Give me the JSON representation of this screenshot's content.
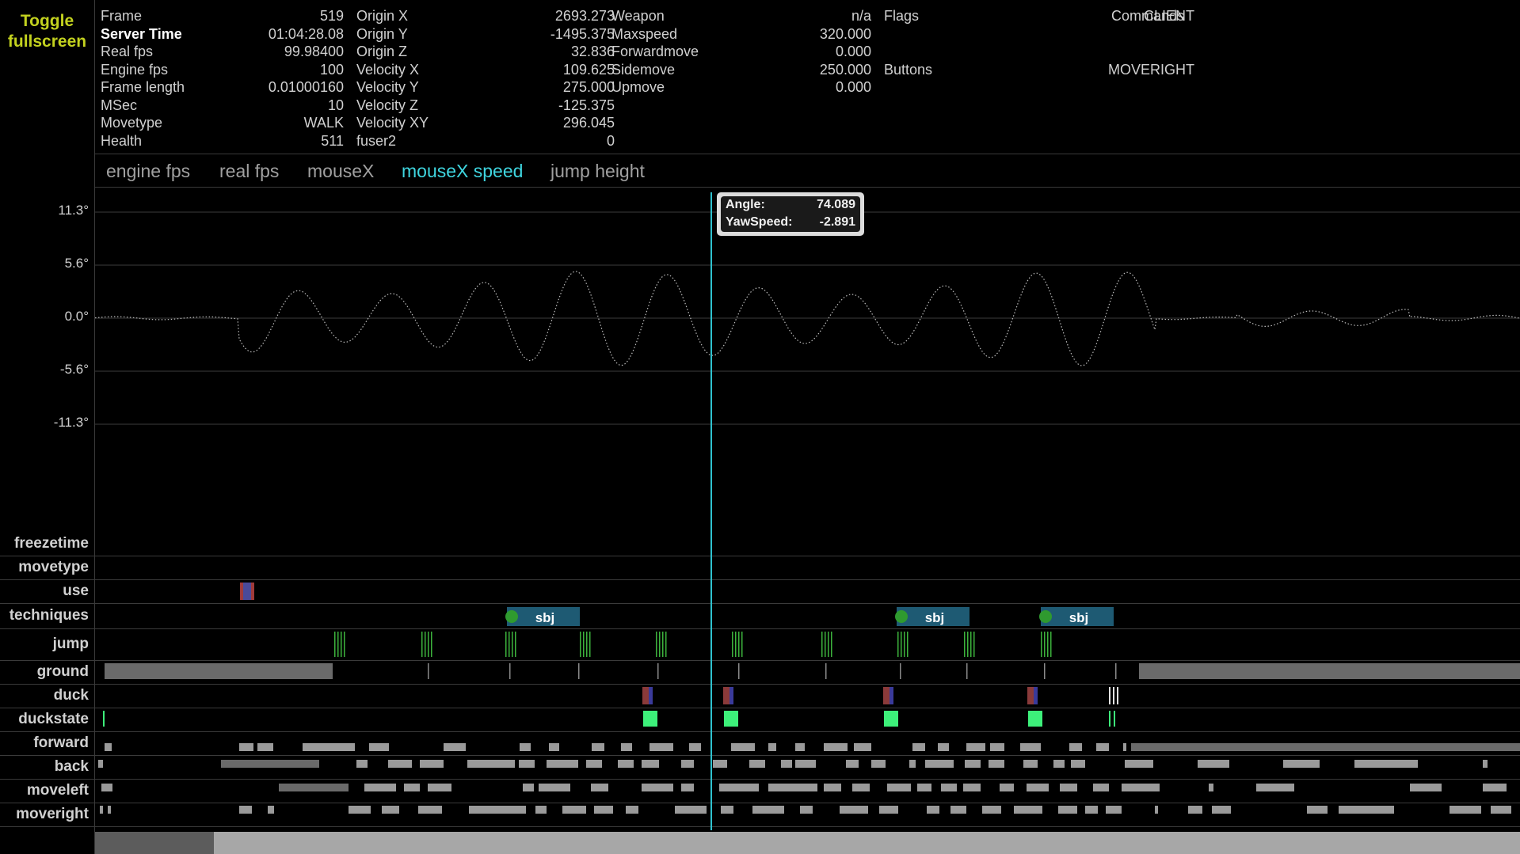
{
  "toggle": {
    "label": "Toggle fullscreen"
  },
  "info": {
    "col1": [
      {
        "label": "Frame",
        "value": "519"
      },
      {
        "label": "Server Time",
        "value": "01:04:28.08",
        "highlight": true
      },
      {
        "label": "Real fps",
        "value": "99.98400"
      },
      {
        "label": "Engine fps",
        "value": "100"
      },
      {
        "label": "Frame length",
        "value": "0.01000160"
      },
      {
        "label": "MSec",
        "value": "10"
      },
      {
        "label": "Movetype",
        "value": "WALK"
      },
      {
        "label": "Health",
        "value": "511"
      }
    ],
    "col2": [
      {
        "label": "Origin X",
        "value": "2693.273"
      },
      {
        "label": "Origin Y",
        "value": "-1495.375"
      },
      {
        "label": "Origin Z",
        "value": "32.836"
      },
      {
        "label": "Velocity X",
        "value": "109.625"
      },
      {
        "label": "Velocity Y",
        "value": "275.000"
      },
      {
        "label": "Velocity Z",
        "value": "-125.375"
      },
      {
        "label": "Velocity XY",
        "value": "296.045"
      },
      {
        "label": "fuser2",
        "value": "0"
      }
    ],
    "col3": [
      {
        "label": "Weapon",
        "value": "n/a"
      },
      {
        "label": "Maxspeed",
        "value": "320.000"
      },
      {
        "label": "Forwardmove",
        "value": "0.000"
      },
      {
        "label": "Sidemove",
        "value": "250.000"
      },
      {
        "label": "Upmove",
        "value": "0.000"
      }
    ],
    "col4": {
      "flags_label": "Flags",
      "flags_value": "CLIENT",
      "buttons_label": "Buttons",
      "buttons_value": "MOVERIGHT"
    },
    "commands_label": "Commands"
  },
  "tabs": [
    {
      "label": "engine fps",
      "active": false
    },
    {
      "label": "real fps",
      "active": false
    },
    {
      "label": "mouseX",
      "active": false
    },
    {
      "label": "mouseX speed",
      "active": true
    },
    {
      "label": "jump height",
      "active": false
    }
  ],
  "graph": {
    "y_ticks": [
      "11.3°",
      "5.6°",
      "0.0°",
      "-5.6°",
      "-11.3°"
    ],
    "tooltip": {
      "angle_label": "Angle:",
      "angle_value": "74.089",
      "yaw_label": "YawSpeed:",
      "yaw_value": "-2.891"
    }
  },
  "tracks": [
    {
      "key": "freezetime",
      "label": "freezetime"
    },
    {
      "key": "movetype",
      "label": "movetype"
    },
    {
      "key": "use",
      "label": "use"
    },
    {
      "key": "techniques",
      "label": "techniques"
    },
    {
      "key": "jump",
      "label": "jump"
    },
    {
      "key": "ground",
      "label": "ground"
    },
    {
      "key": "duck",
      "label": "duck"
    },
    {
      "key": "duckstate",
      "label": "duckstate"
    },
    {
      "key": "forward",
      "label": "forward"
    },
    {
      "key": "back",
      "label": "back"
    },
    {
      "key": "moveleft",
      "label": "moveleft"
    },
    {
      "key": "moveright",
      "label": "moveright"
    }
  ],
  "techniques": [
    {
      "label": "sbj"
    },
    {
      "label": "sbj"
    },
    {
      "label": "sbj"
    }
  ],
  "colors": {
    "accent": "#3fd6e0",
    "toggle": "#c3d21f",
    "technique": "#1e5a73",
    "jump": "#3db33d",
    "duckstate": "#3df07a"
  }
}
